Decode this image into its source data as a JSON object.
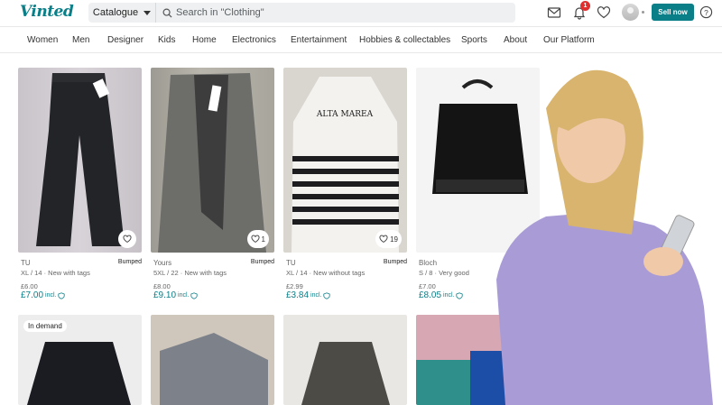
{
  "header": {
    "logo": "Vinted",
    "catalogue": "Catalogue",
    "search_placeholder": "Search in \"Clothing\"",
    "notification_count": "1",
    "sell_label": "Sell now"
  },
  "nav": [
    "Women",
    "Men",
    "Designer",
    "Kids",
    "Home",
    "Electronics",
    "Entertainment",
    "Hobbies & collectables",
    "Sports",
    "About",
    "Our Platform"
  ],
  "items": [
    {
      "brand": "TU",
      "size": "XL / 14 · New with tags",
      "price": "£6.00",
      "price_incl": "£7.00",
      "incl": "incl.",
      "bumped": "Bumped",
      "favs": ""
    },
    {
      "brand": "Yours",
      "size": "5XL / 22 · New with tags",
      "price": "£8.00",
      "price_incl": "£9.10",
      "incl": "incl.",
      "bumped": "Bumped",
      "favs": "1"
    },
    {
      "brand": "TU",
      "size": "XL / 14 · New without tags",
      "price": "£2.99",
      "price_incl": "£3.84",
      "incl": "incl.",
      "bumped": "Bumped",
      "favs": "19"
    },
    {
      "brand": "Bloch",
      "size": "S / 8 · Very good",
      "price": "£7.00",
      "price_incl": "£8.05",
      "incl": "incl.",
      "bumped": "",
      "favs": ""
    }
  ],
  "row2": {
    "demand_label": "In demand"
  },
  "overlay": {
    "product_text": "ALTA MAREA"
  },
  "colors": {
    "accent": "#0a7f88",
    "badge": "#e02f2f"
  }
}
